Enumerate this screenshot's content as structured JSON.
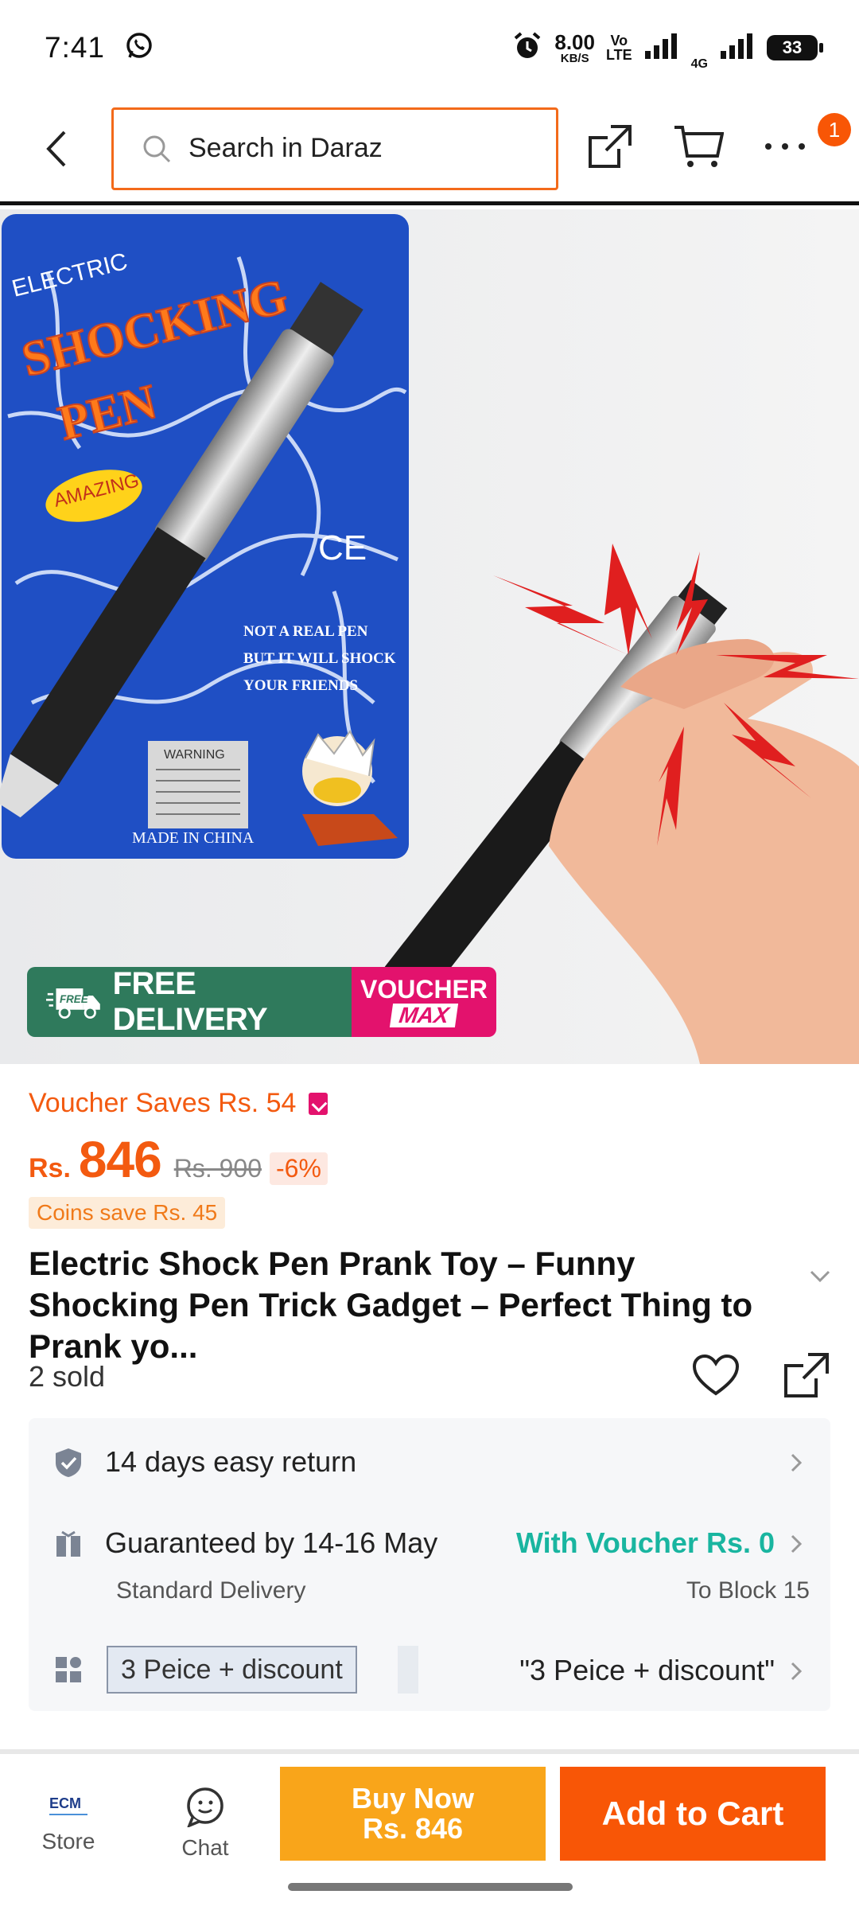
{
  "status_bar": {
    "time": "7:41",
    "net_speed": "8.00",
    "net_unit": "KB/S",
    "volte_top": "Vo",
    "volte_bottom": "LTE",
    "network": "4G",
    "battery": "33"
  },
  "search": {
    "placeholder": "Search in Daraz"
  },
  "header": {
    "cart_badge": "1"
  },
  "product_image": {
    "package_text_1": "ELECTRIC",
    "package_text_2": "SHOCKING",
    "package_text_3": "PEN",
    "package_text_4": "AMAZING",
    "package_text_5": "CE",
    "package_text_6": "NOT A REAL PEN",
    "package_text_7": "BUT IT WILL SHOCK",
    "package_text_8": "YOUR FRIENDS",
    "package_text_9": "WARNING",
    "package_text_10": "MADE IN CHINA"
  },
  "promo": {
    "free_tag": "FREE",
    "free_delivery": "FREE DELIVERY",
    "voucher_line1": "VOUCHER",
    "voucher_line2": "MAX"
  },
  "price": {
    "voucher_saves": "Voucher Saves Rs. 54",
    "currency": "Rs.",
    "current": "846",
    "original": "Rs. 900",
    "discount": "-6%",
    "coins_save": "Coins save Rs. 45"
  },
  "product": {
    "title": "Electric Shock Pen Prank Toy – Funny Shocking Pen Trick Gadget – Perfect Thing to Prank yo...",
    "sold": "2 sold"
  },
  "info": {
    "returns": "14 days easy return",
    "delivery_guarantee": "Guaranteed by 14-16 May",
    "delivery_type": "Standard Delivery",
    "delivery_fee": "With Voucher Rs. 0",
    "delivery_location": "To Block 15",
    "variant_chip": "3 Peice + discount",
    "variant_selected": "\"3 Peice + discount\""
  },
  "bottom_bar": {
    "store_logo": "ECM",
    "store_label": "Store",
    "chat_label": "Chat",
    "buy_now_line1": "Buy Now",
    "buy_now_line2": "Rs. 846",
    "add_to_cart": "Add to Cart"
  },
  "colors": {
    "brand_orange": "#f85606",
    "buy_now": "#f9a51a",
    "delivery_green": "#19b5a0",
    "promo_green": "#2f7a5c",
    "promo_pink": "#e3126d"
  }
}
